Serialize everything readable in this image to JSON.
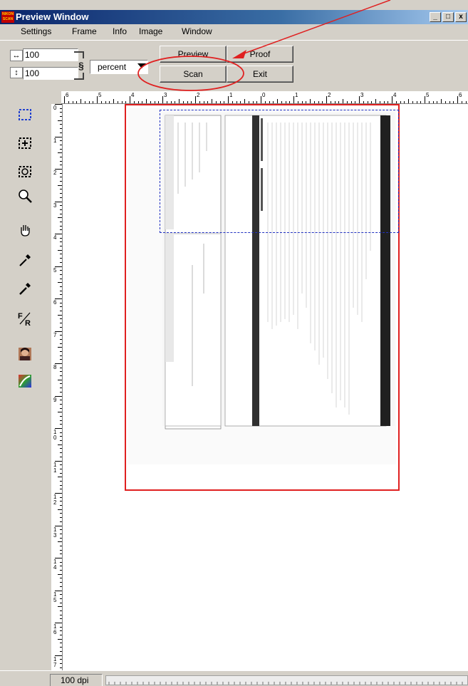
{
  "window": {
    "title": "Preview Window",
    "logo_text": "NIKON SCAN",
    "controls": {
      "minimize": "_",
      "maximize": "□",
      "close": "x"
    }
  },
  "menu": [
    "Settings",
    "Frame",
    "Info",
    "Image",
    "Window"
  ],
  "toolbar": {
    "width_value": "100",
    "height_value": "100",
    "unit_selected": "percent",
    "buttons": {
      "preview": "Preview",
      "proof": "Proof",
      "scan": "Scan",
      "exit": "Exit"
    }
  },
  "ruler_top_labels": [
    "6",
    "5",
    "4",
    "3",
    "2",
    "1",
    "0",
    "1",
    "2",
    "3",
    "4",
    "5",
    "6"
  ],
  "ruler_left_labels": [
    "0",
    "1",
    "2",
    "3",
    "4",
    "5",
    "6",
    "7",
    "8",
    "9",
    "1-0",
    "1-1",
    "1-2",
    "1-3",
    "1-4",
    "1-5",
    "1-6",
    "1-7"
  ],
  "tools": [
    "marquee-select-icon",
    "add-selection-icon",
    "rotate-selection-icon",
    "zoom-magnifier-icon",
    "hand-pan-icon",
    "eyedropper-icon",
    "eyedropper-alt-icon",
    "flip-rotate-icon",
    "image-thumbnail-icon",
    "curves-icon"
  ],
  "status": {
    "dpi": "100 dpi"
  },
  "colors": {
    "annotation": "#e02020",
    "selection": "#2030c0",
    "titlebar": "#0a246a"
  }
}
